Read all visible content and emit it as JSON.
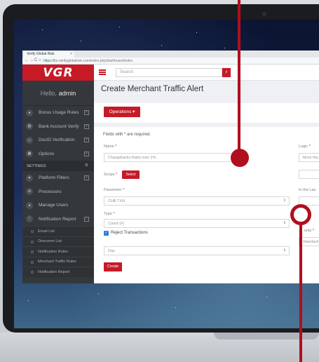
{
  "browser": {
    "tab_title": "Verify Global Risk",
    "tab_close": "×",
    "url_https": "https://",
    "url_rest": "bo.verifyglobalrisk.com/index.php/dashboard/index",
    "nav_back": "←",
    "nav_forward": "→",
    "nav_reload": "C",
    "nav_home": "⌂"
  },
  "brand": {
    "logo_text": "VGR"
  },
  "sidebar": {
    "greeting": "Hello,",
    "username": "admin",
    "items": [
      {
        "label": "Bonus Usage Rules",
        "icon": "bonus-icon",
        "glyph": "●"
      },
      {
        "label": "Bank Account Verify",
        "icon": "bank-icon",
        "glyph": "▤"
      },
      {
        "label": "DocID Verification",
        "icon": "id-card-icon",
        "glyph": "▭"
      },
      {
        "label": "Options",
        "icon": "options-icon",
        "glyph": "▦"
      }
    ],
    "settings_label": "SETTINGS",
    "settings_icon_glyph": "⚙",
    "settings_items": [
      {
        "label": "Platform Filters",
        "icon": "filter-icon",
        "glyph": "▼"
      },
      {
        "label": "Processors",
        "icon": "processors-icon",
        "glyph": "⚙"
      },
      {
        "label": "Manage Users",
        "icon": "users-icon",
        "glyph": "●"
      },
      {
        "label": "Notification Report",
        "icon": "notification-icon",
        "glyph": "!"
      }
    ],
    "sub_items": [
      "Email List",
      "Onscreen List",
      "Notification Rules",
      "Merchant Traffic Rules",
      "Notification Report"
    ]
  },
  "topbar": {
    "search_placeholder": "Search",
    "search_glyph": "⌕"
  },
  "page": {
    "title": "Create Merchant Traffic Alert"
  },
  "operations": {
    "label": "Operations ▾"
  },
  "form": {
    "required_note_prefix": "Fields with",
    "required_note_star": "*",
    "required_note_suffix": "are required.",
    "name_label": "Name",
    "name_value": "Chargebacks Ratio over 2%",
    "scope_label": "Scope",
    "scope_button": "Select",
    "parameter_label": "Parameter",
    "parameter_value": "CHB TXN",
    "type_label": "Type",
    "type_value": "Count (#)",
    "reject_label": "Reject Transactions",
    "period_value": "Day",
    "create_button": "Create",
    "logic_label": "Logic",
    "logic_value": "More tha",
    "in_the_last_label": "In the Las",
    "priority_label": "ority",
    "priority_value": "Standard",
    "star": "*",
    "caret": "⇕"
  },
  "colors": {
    "accent": "#c61a27",
    "sidebar_bg": "#34373b",
    "checkbox": "#2a7fd4"
  }
}
